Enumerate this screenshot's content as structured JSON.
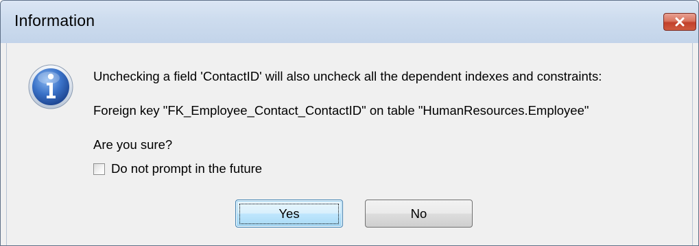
{
  "window": {
    "title": "Information"
  },
  "icons": {
    "dialog_icon": "info-icon",
    "close_icon": "close-icon"
  },
  "colors": {
    "close_button": "#c9503a",
    "info_icon": "#2f64b8",
    "default_button_border": "#3c7fb1"
  },
  "message": {
    "line1": "Unchecking a field 'ContactID' will also uncheck all the dependent indexes and constraints:",
    "line2": "Foreign key \"FK_Employee_Contact_ContactID\" on table \"HumanResources.Employee\"",
    "line3": "Are you sure?"
  },
  "checkbox": {
    "label": "Do not prompt in the future",
    "checked": false
  },
  "buttons": {
    "yes_label": "Yes",
    "no_label": "No"
  }
}
